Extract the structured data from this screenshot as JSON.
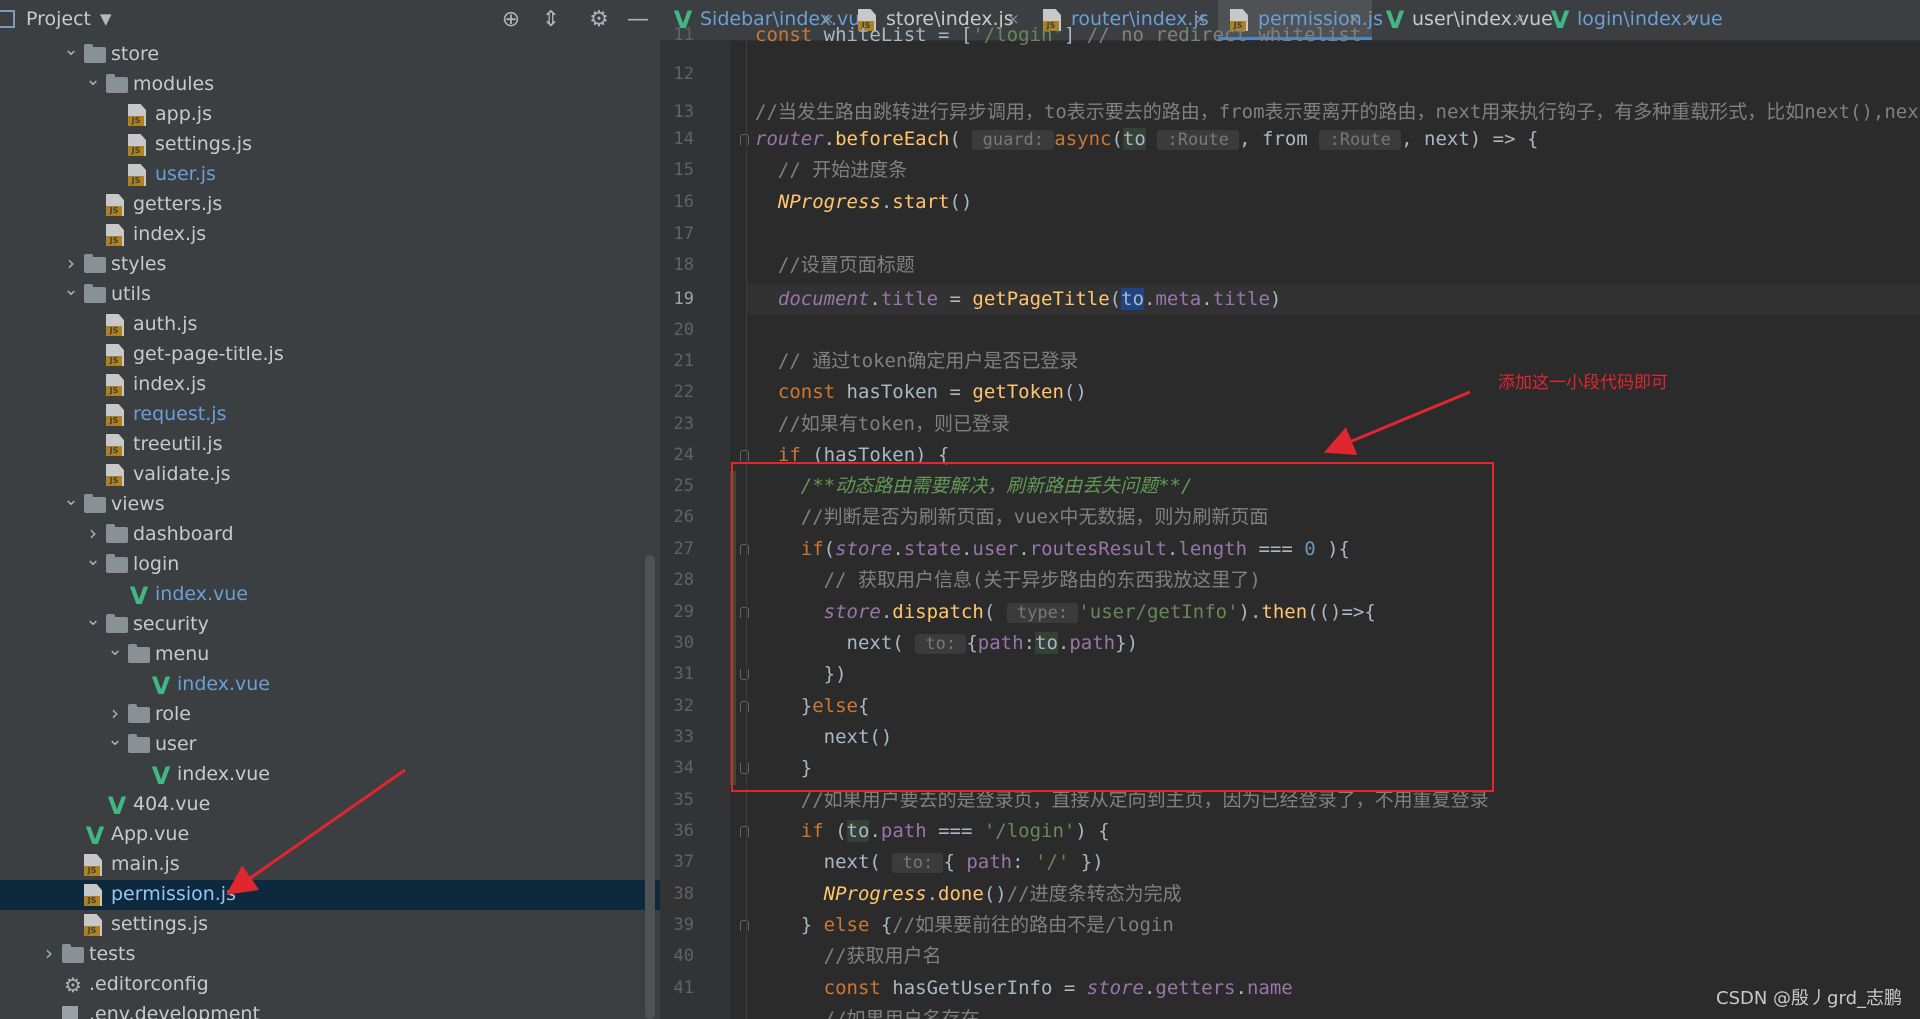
{
  "project_panel": {
    "title": "Project",
    "tree": [
      {
        "label": "store",
        "kind": "folder",
        "depth": 1,
        "expanded": true
      },
      {
        "label": "modules",
        "kind": "folder",
        "depth": 2,
        "expanded": true
      },
      {
        "label": "app.js",
        "kind": "js",
        "depth": 3
      },
      {
        "label": "settings.js",
        "kind": "js",
        "depth": 3
      },
      {
        "label": "user.js",
        "kind": "js",
        "depth": 3,
        "modified": true
      },
      {
        "label": "getters.js",
        "kind": "js",
        "depth": 2
      },
      {
        "label": "index.js",
        "kind": "js",
        "depth": 2
      },
      {
        "label": "styles",
        "kind": "folder",
        "depth": 1,
        "expanded": false
      },
      {
        "label": "utils",
        "kind": "folder",
        "depth": 1,
        "expanded": true
      },
      {
        "label": "auth.js",
        "kind": "js",
        "depth": 2
      },
      {
        "label": "get-page-title.js",
        "kind": "js",
        "depth": 2
      },
      {
        "label": "index.js",
        "kind": "js",
        "depth": 2
      },
      {
        "label": "request.js",
        "kind": "js",
        "depth": 2,
        "modified": true
      },
      {
        "label": "treeutil.js",
        "kind": "js",
        "depth": 2
      },
      {
        "label": "validate.js",
        "kind": "js",
        "depth": 2
      },
      {
        "label": "views",
        "kind": "folder",
        "depth": 1,
        "expanded": true
      },
      {
        "label": "dashboard",
        "kind": "folder",
        "depth": 2,
        "expanded": false
      },
      {
        "label": "login",
        "kind": "folder",
        "depth": 2,
        "expanded": true
      },
      {
        "label": "index.vue",
        "kind": "vue",
        "depth": 3,
        "modified": true
      },
      {
        "label": "security",
        "kind": "folder",
        "depth": 2,
        "expanded": true
      },
      {
        "label": "menu",
        "kind": "folder",
        "depth": 3,
        "expanded": true
      },
      {
        "label": "index.vue",
        "kind": "vue",
        "depth": 4,
        "modified": true
      },
      {
        "label": "role",
        "kind": "folder",
        "depth": 3,
        "expanded": false
      },
      {
        "label": "user",
        "kind": "folder",
        "depth": 3,
        "expanded": true
      },
      {
        "label": "index.vue",
        "kind": "vue",
        "depth": 4
      },
      {
        "label": "404.vue",
        "kind": "vue",
        "depth": 2
      },
      {
        "label": "App.vue",
        "kind": "vue",
        "depth": 1
      },
      {
        "label": "main.js",
        "kind": "js",
        "depth": 1
      },
      {
        "label": "permission.js",
        "kind": "js",
        "depth": 1,
        "selected": true
      },
      {
        "label": "settings.js",
        "kind": "js",
        "depth": 1
      },
      {
        "label": "tests",
        "kind": "folder",
        "depth": 0,
        "expanded": false
      },
      {
        "label": ".editorconfig",
        "kind": "gear",
        "depth": 0
      },
      {
        "label": ".env.development",
        "kind": "file",
        "depth": 0
      }
    ]
  },
  "tabs": [
    {
      "label": "Sidebar\\index.vue",
      "kind": "vue",
      "modified": true
    },
    {
      "label": "store\\index.js",
      "kind": "js"
    },
    {
      "label": "router\\index.js",
      "kind": "js",
      "modified": true
    },
    {
      "label": "permission.js",
      "kind": "js",
      "active": true,
      "modified": true
    },
    {
      "label": "user\\index.vue",
      "kind": "vue"
    },
    {
      "label": "login\\index.vue",
      "kind": "vue",
      "modified": true
    }
  ],
  "editor": {
    "current_line": 19,
    "line_numbers": [
      "11",
      "12",
      "13",
      "14",
      "15",
      "16",
      "17",
      "18",
      "19",
      "20",
      "21",
      "22",
      "23",
      "24",
      "25",
      "26",
      "27",
      "28",
      "29",
      "30",
      "31",
      "32",
      "33",
      "34",
      "35",
      "36",
      "37",
      "38",
      "39",
      "40",
      "41"
    ],
    "annotation_note": "添加这一小段代码即可"
  },
  "watermark": "CSDN @殷丿grd_志鹏"
}
